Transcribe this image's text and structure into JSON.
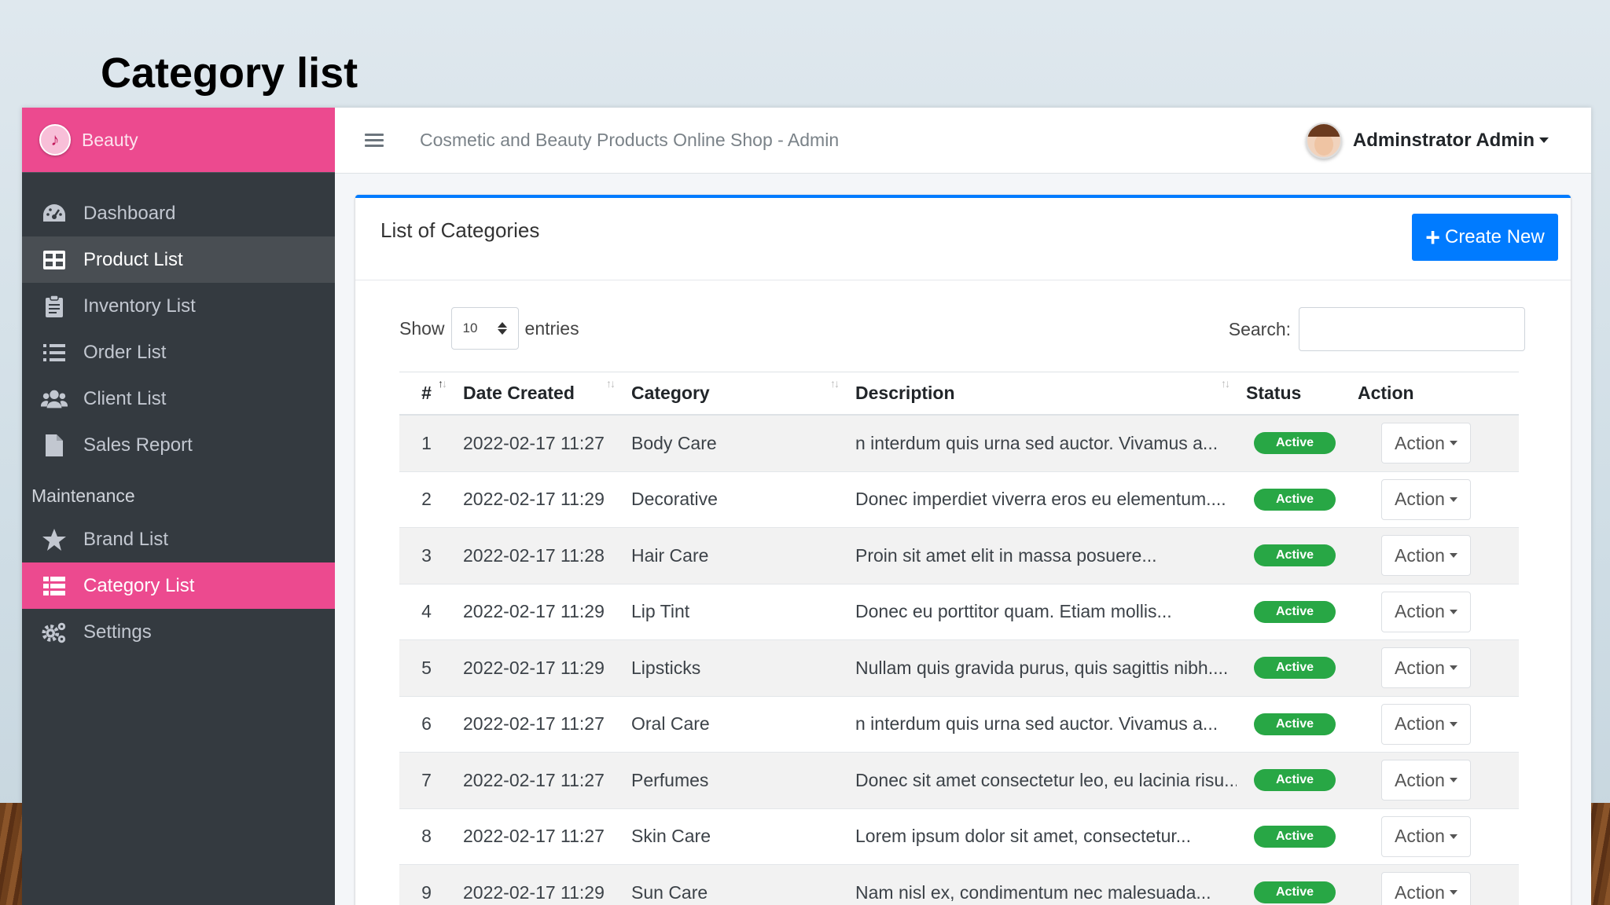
{
  "slide": {
    "title": "Category list"
  },
  "sidebar": {
    "brand": "Beauty",
    "items": [
      {
        "label": "Dashboard",
        "icon": "dashboard-icon"
      },
      {
        "label": "Product List",
        "icon": "table-icon"
      },
      {
        "label": "Inventory List",
        "icon": "clipboard-icon"
      },
      {
        "label": "Order List",
        "icon": "list-icon"
      },
      {
        "label": "Client List",
        "icon": "users-icon"
      },
      {
        "label": "Sales Report",
        "icon": "file-icon"
      }
    ],
    "section_header": "Maintenance",
    "maintenance_items": [
      {
        "label": "Brand List",
        "icon": "star-icon"
      },
      {
        "label": "Category List",
        "icon": "th-list-icon"
      },
      {
        "label": "Settings",
        "icon": "cogs-icon"
      }
    ]
  },
  "topbar": {
    "app_title": "Cosmetic and Beauty Products Online Shop - Admin",
    "user_name": "Adminstrator Admin"
  },
  "card": {
    "title": "List of Categories",
    "create_label": "Create New"
  },
  "controls": {
    "show_label": "Show",
    "entries_value": "10",
    "entries_label": "entries",
    "search_label": "Search:"
  },
  "table": {
    "headers": [
      "#",
      "Date Created",
      "Category",
      "Description",
      "Status",
      "Action"
    ],
    "rows": [
      {
        "num": "1",
        "date": "2022-02-17 11:27",
        "category": "Body Care",
        "description": "n interdum quis urna sed auctor. Vivamus a...",
        "status": "Active",
        "action": "Action"
      },
      {
        "num": "2",
        "date": "2022-02-17 11:29",
        "category": "Decorative",
        "description": "Donec imperdiet viverra eros eu elementum....",
        "status": "Active",
        "action": "Action"
      },
      {
        "num": "3",
        "date": "2022-02-17 11:28",
        "category": "Hair Care",
        "description": "Proin sit amet elit in massa posuere...",
        "status": "Active",
        "action": "Action"
      },
      {
        "num": "4",
        "date": "2022-02-17 11:29",
        "category": "Lip Tint",
        "description": "Donec eu porttitor quam. Etiam mollis...",
        "status": "Active",
        "action": "Action"
      },
      {
        "num": "5",
        "date": "2022-02-17 11:29",
        "category": "Lipsticks",
        "description": "Nullam quis gravida purus, quis sagittis nibh....",
        "status": "Active",
        "action": "Action"
      },
      {
        "num": "6",
        "date": "2022-02-17 11:27",
        "category": "Oral Care",
        "description": "n interdum quis urna sed auctor. Vivamus a...",
        "status": "Active",
        "action": "Action"
      },
      {
        "num": "7",
        "date": "2022-02-17 11:27",
        "category": "Perfumes",
        "description": "Donec sit amet consectetur leo, eu lacinia risu...",
        "status": "Active",
        "action": "Action"
      },
      {
        "num": "8",
        "date": "2022-02-17 11:27",
        "category": "Skin Care",
        "description": "Lorem ipsum dolor sit amet, consectetur...",
        "status": "Active",
        "action": "Action"
      },
      {
        "num": "9",
        "date": "2022-02-17 11:29",
        "category": "Sun Care",
        "description": "Nam nisl ex, condimentum nec malesuada...",
        "status": "Active",
        "action": "Action"
      }
    ]
  },
  "colors": {
    "brand_pink": "#ec4a8f",
    "sidebar_bg": "#343a40",
    "primary": "#007bff",
    "success": "#28a745"
  }
}
